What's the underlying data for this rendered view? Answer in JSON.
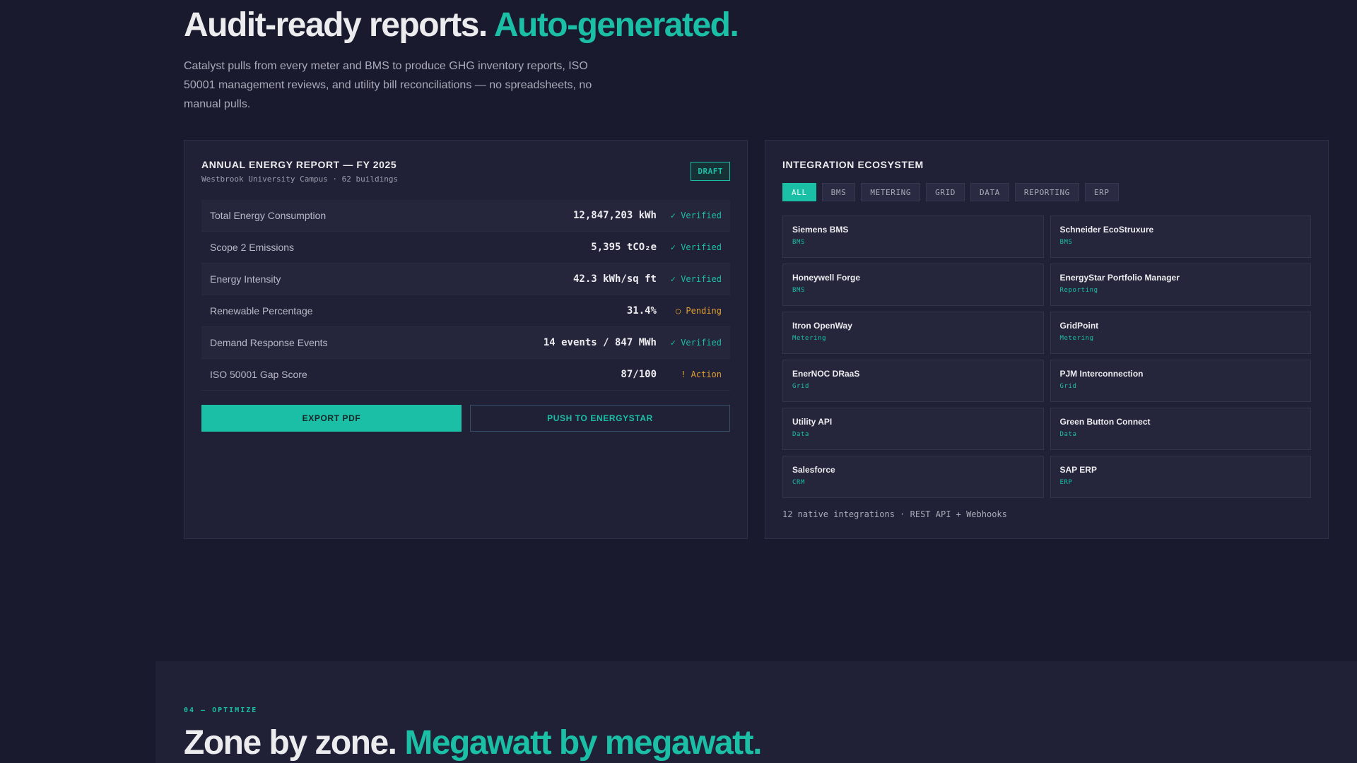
{
  "hero": {
    "title_main": "Audit-ready reports.",
    "title_accent": "Auto-generated.",
    "description": "Catalyst pulls from every meter and BMS to produce GHG inventory reports, ISO 50001 management reviews, and utility bill reconciliations — no spreadsheets, no manual pulls."
  },
  "report": {
    "title": "ANNUAL ENERGY REPORT — FY 2025",
    "subtitle": "Westbrook University Campus · 62 buildings",
    "badge": "DRAFT",
    "rows": [
      {
        "label": "Total Energy Consumption",
        "value": "12,847,203 kWh",
        "status": "✓ Verified",
        "status_type": "verified"
      },
      {
        "label": "Scope 2 Emissions",
        "value": "5,395 tCO₂e",
        "status": "✓ Verified",
        "status_type": "verified"
      },
      {
        "label": "Energy Intensity",
        "value": "42.3 kWh/sq ft",
        "status": "✓ Verified",
        "status_type": "verified"
      },
      {
        "label": "Renewable Percentage",
        "value": "31.4%",
        "status": "○ Pending",
        "status_type": "pending"
      },
      {
        "label": "Demand Response Events",
        "value": "14 events / 847 MWh",
        "status": "✓ Verified",
        "status_type": "verified"
      },
      {
        "label": "ISO 50001 Gap Score",
        "value": "87/100",
        "status": "! Action",
        "status_type": "action"
      }
    ],
    "export_label": "EXPORT PDF",
    "push_label": "PUSH TO ENERGYSTAR"
  },
  "integrations": {
    "title": "INTEGRATION ECOSYSTEM",
    "filters": [
      "ALL",
      "BMS",
      "METERING",
      "GRID",
      "DATA",
      "REPORTING",
      "ERP"
    ],
    "active_filter": "ALL",
    "items": [
      {
        "name": "Siemens BMS",
        "category": "BMS"
      },
      {
        "name": "Schneider EcoStruxure",
        "category": "BMS"
      },
      {
        "name": "Honeywell Forge",
        "category": "BMS"
      },
      {
        "name": "EnergyStar Portfolio Manager",
        "category": "Reporting"
      },
      {
        "name": "Itron OpenWay",
        "category": "Metering"
      },
      {
        "name": "GridPoint",
        "category": "Metering"
      },
      {
        "name": "EnerNOC DRaaS",
        "category": "Grid"
      },
      {
        "name": "PJM Interconnection",
        "category": "Grid"
      },
      {
        "name": "Utility API",
        "category": "Data"
      },
      {
        "name": "Green Button Connect",
        "category": "Data"
      },
      {
        "name": "Salesforce",
        "category": "CRM"
      },
      {
        "name": "SAP ERP",
        "category": "ERP"
      }
    ],
    "footer": "12 native integrations · REST API + Webhooks"
  },
  "optimize": {
    "eyebrow": "04 — OPTIMIZE",
    "title_main": "Zone by zone.",
    "title_accent": "Megawatt by megawatt."
  },
  "colors": {
    "background": "#191a2e",
    "panel": "#202136",
    "accent": "#1bbfa6",
    "warning": "#e0a030"
  }
}
